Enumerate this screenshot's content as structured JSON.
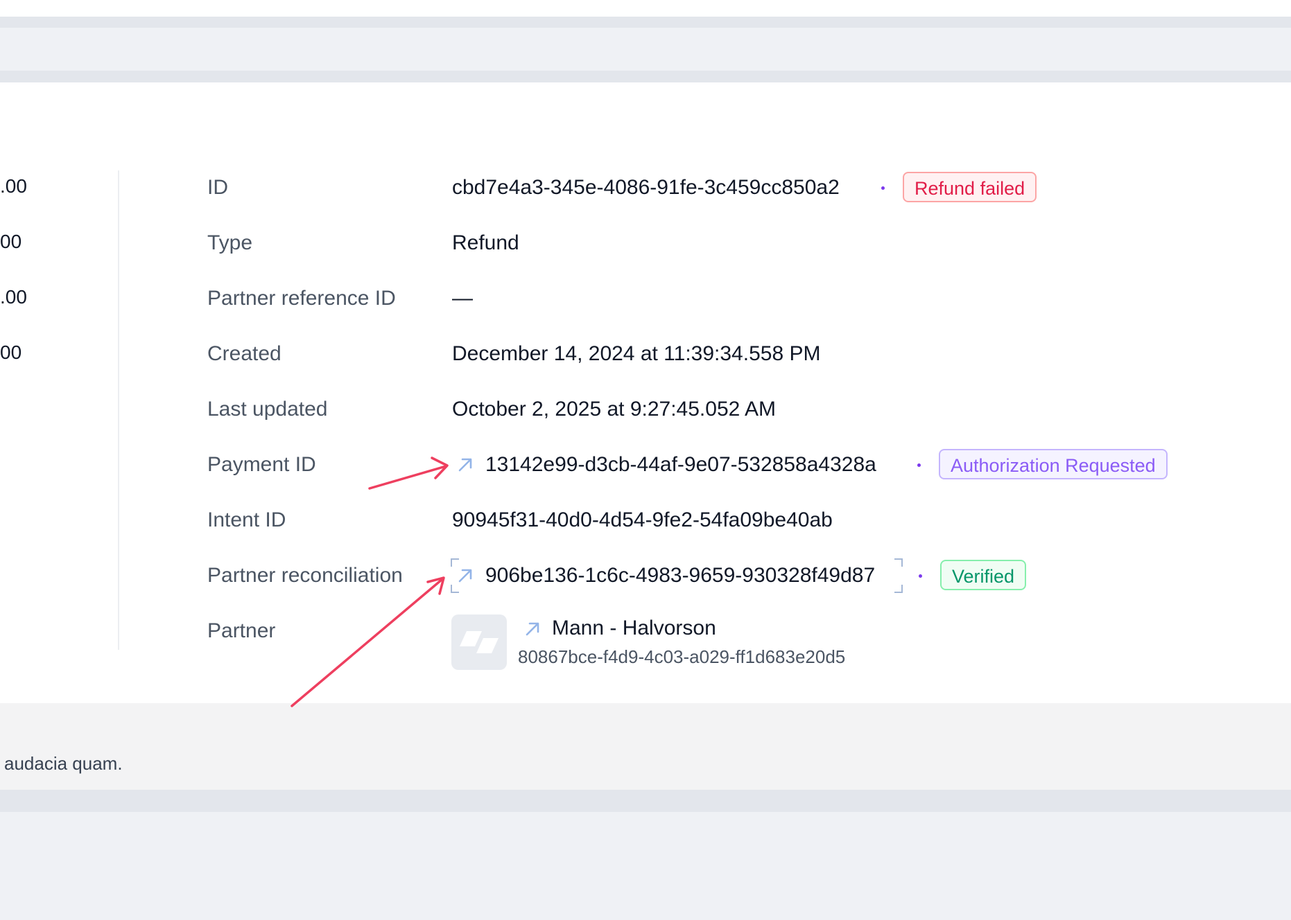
{
  "amounts_partial": [
    ".00",
    "00",
    ".00",
    "00"
  ],
  "details": {
    "id": {
      "label": "ID",
      "value": "cbd7e4a3-345e-4086-91fe-3c459cc850a2",
      "badge": "Refund failed"
    },
    "type": {
      "label": "Type",
      "value": "Refund"
    },
    "partner_reference_id": {
      "label": "Partner reference ID",
      "value": "—"
    },
    "created": {
      "label": "Created",
      "value": "December 14, 2024 at 11:39:34.558 PM"
    },
    "last_updated": {
      "label": "Last updated",
      "value": "October 2, 2025 at 9:27:45.052 AM"
    },
    "payment_id": {
      "label": "Payment ID",
      "value": "13142e99-d3cb-44af-9e07-532858a4328a",
      "badge": "Authorization Requested"
    },
    "intent_id": {
      "label": "Intent ID",
      "value": "90945f31-40d0-4d54-9fe2-54fa09be40ab"
    },
    "partner_reconciliation": {
      "label": "Partner reconciliation",
      "value": "906be136-1c6c-4983-9659-930328f49d87",
      "badge": "Verified"
    },
    "partner": {
      "label": "Partner",
      "name": "Mann - Halvorson",
      "id": "80867bce-f4d9-4c03-a029-ff1d683e20d5"
    }
  },
  "footer": {
    "text": "audacia quam."
  },
  "colors": {
    "badge_red": "#e11d48",
    "badge_purple": "#8b5cf6",
    "badge_green": "#059669",
    "link_icon": "#93b4e8",
    "annotation_arrow": "#ee3f5f"
  },
  "icons": [
    "external-link-arrow-icon",
    "partner-logo-icon",
    "separator-dot"
  ]
}
